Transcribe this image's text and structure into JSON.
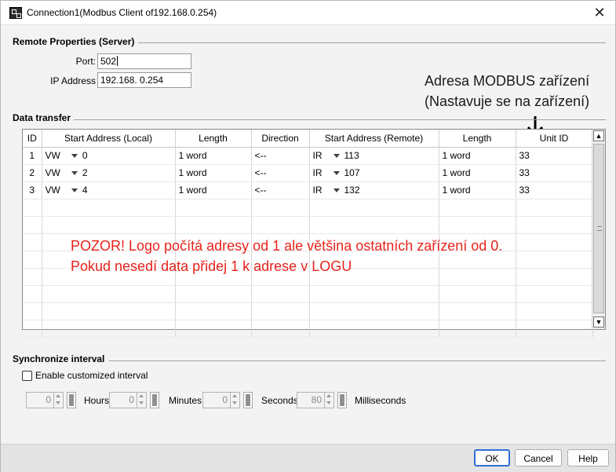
{
  "window": {
    "title": "Connection1(Modbus Client of192.168.0.254)",
    "close_glyph": "✕"
  },
  "remote": {
    "section_title": "Remote Properties (Server)",
    "port_label": "Port:",
    "port_value": "502",
    "ip_label": "IP Address",
    "ip_value": "192.168.  0.254"
  },
  "annotation": {
    "line1": "Adresa MODBUS zařízení",
    "line2": "(Nastavuje se na zařízení)"
  },
  "data_transfer": {
    "section_title": "Data transfer",
    "columns": [
      "ID",
      "Start Address (Local)",
      "Length",
      "Direction",
      "Start Address (Remote)",
      "Length",
      "Unit ID"
    ],
    "rows": [
      {
        "id": "1",
        "local_type": "VW",
        "local_addr": "0",
        "length": "1 word",
        "direction": "<--",
        "remote_type": "IR",
        "remote_addr": "113",
        "remote_length": "1 word",
        "unit_id": "33"
      },
      {
        "id": "2",
        "local_type": "VW",
        "local_addr": "2",
        "length": "1 word",
        "direction": "<--",
        "remote_type": "IR",
        "remote_addr": "107",
        "remote_length": "1 word",
        "unit_id": "33"
      },
      {
        "id": "3",
        "local_type": "VW",
        "local_addr": "4",
        "length": "1 word",
        "direction": "<--",
        "remote_type": "IR",
        "remote_addr": "132",
        "remote_length": "1 word",
        "unit_id": "33"
      }
    ]
  },
  "warning": {
    "line1": "POZOR! Logo počítá adresy od 1 ale většina ostatních zařízení od 0.",
    "line2": "Pokud nesedí data přidej 1 k adrese v LOGU"
  },
  "sync": {
    "section_title": "Synchronize interval",
    "checkbox_label": "Enable customized interval",
    "checked": false,
    "hours_value": "0",
    "hours_label": "Hours",
    "minutes_value": "0",
    "minutes_label": "Minutes",
    "seconds_value": "0",
    "seconds_label": "Seconds",
    "ms_value": "80",
    "ms_label": "Milliseconds"
  },
  "buttons": {
    "ok": "OK",
    "cancel": "Cancel",
    "help": "Help"
  },
  "colors": {
    "warning_text": "#e8231c",
    "ok_border": "#2f6fd6"
  }
}
